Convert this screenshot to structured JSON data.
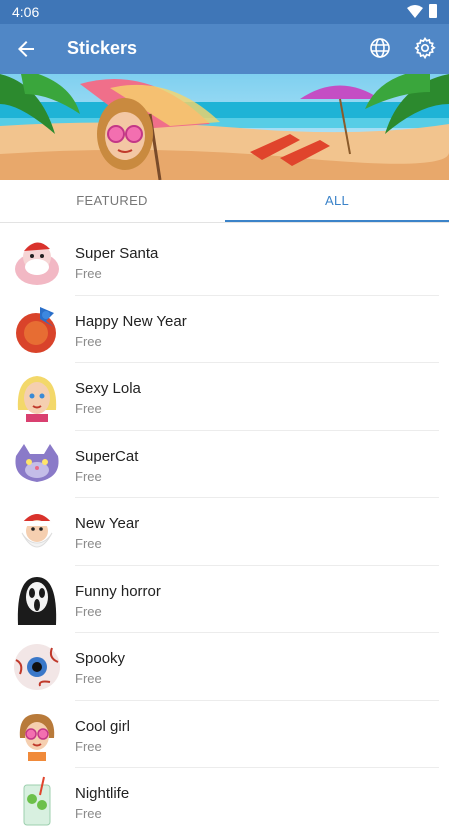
{
  "status_bar": {
    "time": "4:06",
    "wifi_icon": "wifi-icon",
    "battery_icon": "battery-icon"
  },
  "app_bar": {
    "title": "Stickers",
    "back_icon": "arrow-back-icon",
    "globe_icon": "globe-icon",
    "settings_icon": "gear-icon",
    "color": "#5087c6"
  },
  "tabs": [
    {
      "label": "FEATURED",
      "selected": false
    },
    {
      "label": "ALL",
      "selected": true
    }
  ],
  "accent_color": "#3b83c9",
  "stickers": [
    {
      "name": "Super Santa",
      "price": "Free"
    },
    {
      "name": "Happy New Year",
      "price": "Free"
    },
    {
      "name": "Sexy Lola",
      "price": "Free"
    },
    {
      "name": "SuperCat",
      "price": "Free"
    },
    {
      "name": "New Year",
      "price": "Free"
    },
    {
      "name": "Funny horror",
      "price": "Free"
    },
    {
      "name": "Spooky",
      "price": "Free"
    },
    {
      "name": "Cool girl",
      "price": "Free"
    },
    {
      "name": "Nightlife",
      "price": "Free"
    }
  ]
}
